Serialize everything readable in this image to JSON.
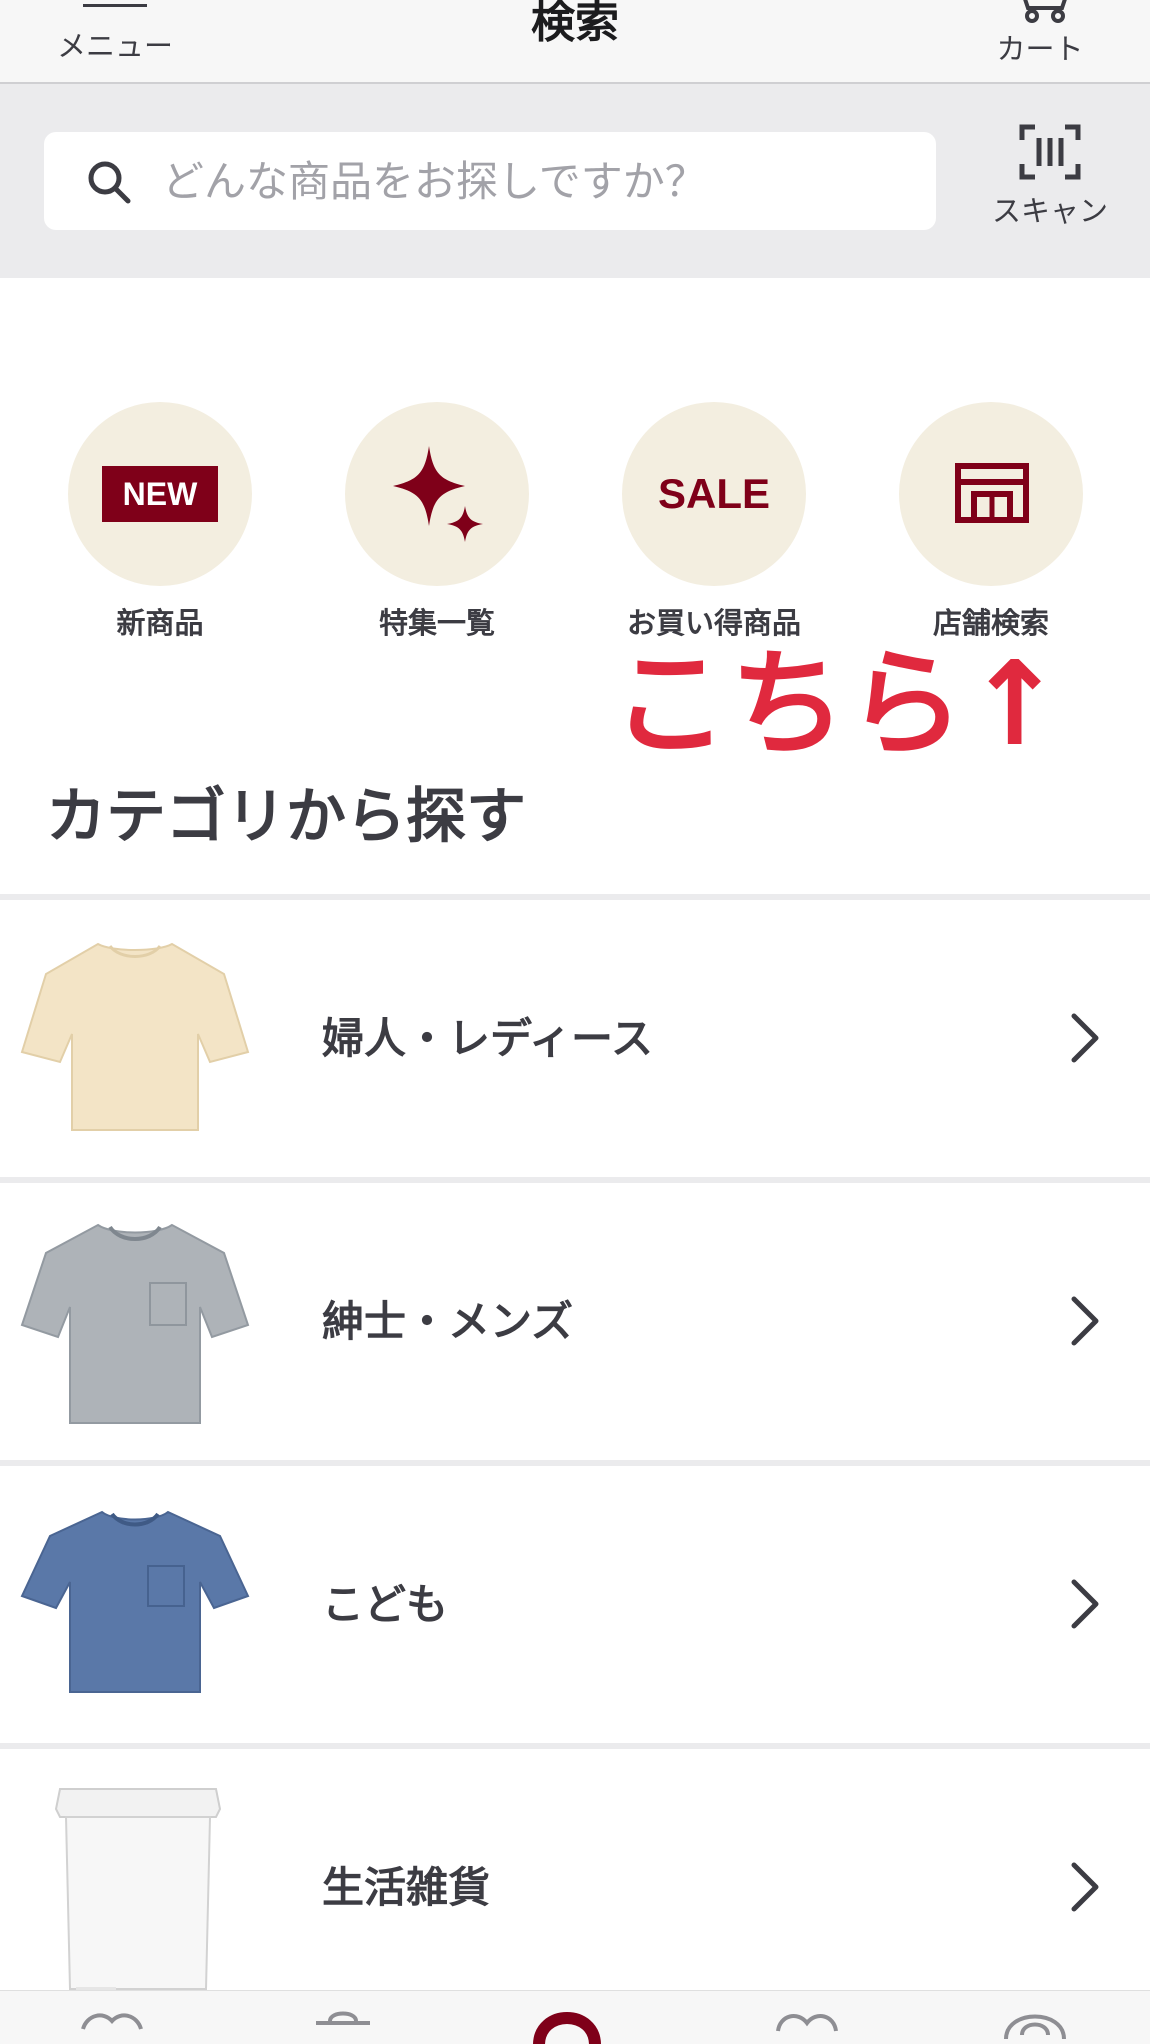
{
  "header": {
    "menu_label": "メニュー",
    "title": "検索",
    "cart_label": "カート"
  },
  "search": {
    "placeholder": "どんな商品をお探しですか？",
    "scan_label": "スキャン"
  },
  "shortcuts": [
    {
      "label": "新商品",
      "icon": "new-badge-icon",
      "badge_text": "NEW"
    },
    {
      "label": "特集一覧",
      "icon": "sparkle-icon"
    },
    {
      "label": "お買い得商品",
      "icon": "sale-icon",
      "badge_text": "SALE"
    },
    {
      "label": "店舗検索",
      "icon": "store-icon"
    }
  ],
  "annotation": "こちら↑",
  "section_title": "カテゴリから探す",
  "categories": [
    {
      "label": "婦人・レディース",
      "thumbnail": "beige-tshirt"
    },
    {
      "label": "紳士・メンズ",
      "thumbnail": "gray-pocket-tshirt"
    },
    {
      "label": "こども",
      "thumbnail": "blue-pocket-tshirt"
    },
    {
      "label": "生活雑貨",
      "thumbnail": "white-trash-bin"
    }
  ],
  "tabbar": [
    {
      "icon": "home-icon"
    },
    {
      "icon": "bag-icon"
    },
    {
      "icon": "location-pin-icon",
      "active": true
    },
    {
      "icon": "heart-icon"
    },
    {
      "icon": "account-icon"
    }
  ],
  "colors": {
    "brand": "#7f0019",
    "circle_bg": "#f3eee0",
    "annotation": "#e0293e",
    "header_bg": "#f7f7f7",
    "search_band_bg": "#ebebed"
  }
}
